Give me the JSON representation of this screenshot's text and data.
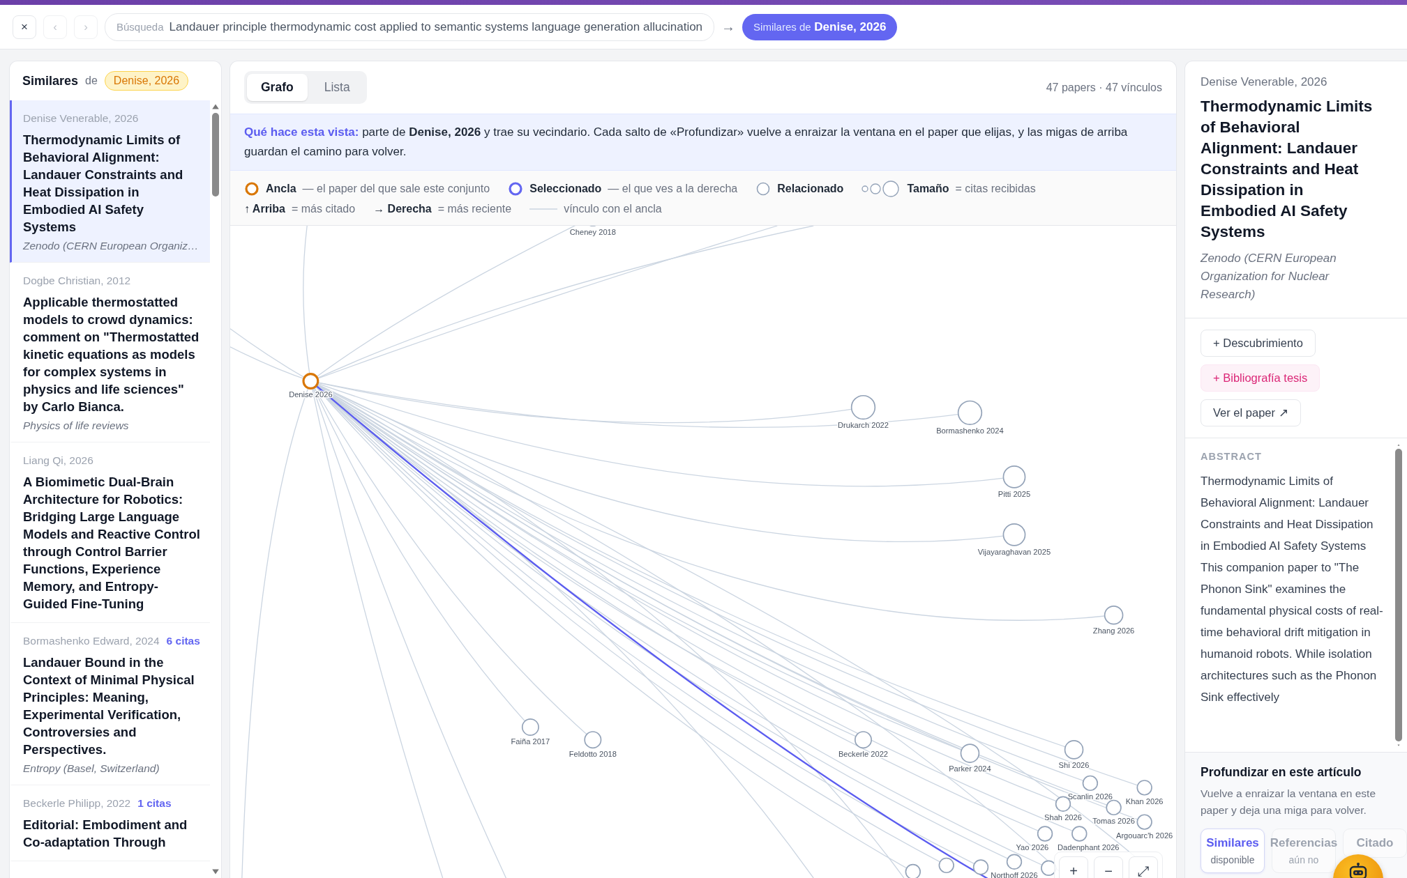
{
  "toolbar": {
    "close": "×",
    "back": "‹",
    "forward": "›",
    "back_disabled": true,
    "forward_disabled": true,
    "search": {
      "label": "Búsqueda",
      "value": "Landauer principle thermodynamic cost applied to semantic systems language generation allucination"
    },
    "arrow": "→",
    "crumb": {
      "prefix": "Similares de",
      "name": "Denise, 2026"
    }
  },
  "left": {
    "title": "Similares",
    "de": "de",
    "anchor": "Denise, 2026",
    "items": [
      {
        "meta": "Denise Venerable, 2026",
        "title": "Thermodynamic Limits of Behavioral Alignment: Landauer Constraints and Heat Dissipation in Embodied AI Safety Systems",
        "venue": "Zenodo (CERN European Organiz…",
        "selected": true
      },
      {
        "meta": "Dogbe Christian, 2012",
        "title": "Applicable thermostatted models to crowd dynamics: comment on \"Thermostatted kinetic equations as models for complex systems in physics and life sciences\" by Carlo Bianca.",
        "venue": "Physics of life reviews",
        "selected": false
      },
      {
        "meta": "Liang Qi, 2026",
        "title": "A Biomimetic Dual-Brain Architecture for Robotics: Bridging Large Language Models and Reactive Control through Control Barrier Functions, Experience Memory, and Entropy-Guided Fine-Tuning",
        "selected": false
      },
      {
        "meta": "Bormashenko Edward, 2024",
        "citas": "6 citas",
        "title": "Landauer Bound in the Context of Minimal Physical Principles: Meaning, Experimental Verification, Controversies and Perspectives.",
        "venue": "Entropy (Basel, Switzerland)",
        "selected": false
      },
      {
        "meta": "Beckerle Philipp, 2022",
        "citas": "1 citas",
        "title": "Editorial: Embodiment and Co-adaptation Through",
        "selected": false
      }
    ]
  },
  "center": {
    "tabs": [
      {
        "label": "Grafo",
        "selected": true
      },
      {
        "label": "Lista",
        "selected": false
      }
    ],
    "count": "47 papers · 47 vínculos",
    "info": "**Qué hace esta vista:** parte de **Denise, 2026** y trae su vecindario. Cada salto de «Profundizar» vuelve a enraizar la ventana en el paper que elijas, y las migas de arriba guardan el camino para volver.",
    "legend": [
      {
        "kind": "anchor",
        "label": "Ancla",
        "desc": "— el paper del que sale este conjunto"
      },
      {
        "kind": "selected",
        "label": "Seleccionado",
        "desc": "— el que ves a la derecha"
      },
      {
        "kind": "related",
        "label": "Relacionado"
      },
      {
        "kind": "size",
        "label": "Tamaño",
        "desc": "= citas recibidas"
      },
      {
        "kind": "arrow",
        "arrow": "↑",
        "label": "Arriba",
        "desc": "= más citado"
      },
      {
        "kind": "arrow",
        "arrow": "→",
        "label": "Derecha",
        "desc": "= más reciente"
      },
      {
        "kind": "edge",
        "desc": "vínculo con el ancla"
      }
    ],
    "nodes": [
      {
        "label": "Denise 2026",
        "kind": "anchor"
      },
      {
        "label": "Cheney 2018",
        "kind": "related"
      },
      {
        "label": "Drukarch 2022",
        "kind": "related"
      },
      {
        "label": "Bormashenko 2024",
        "kind": "related"
      },
      {
        "label": "Pitti 2025",
        "kind": "related"
      },
      {
        "label": "Vijayaraghavan 2025",
        "kind": "related"
      },
      {
        "label": "Zhang 2026",
        "kind": "related"
      },
      {
        "label": "Faiña 2017",
        "kind": "related"
      },
      {
        "label": "Feldotto 2018",
        "kind": "related"
      },
      {
        "label": "Beckerle 2022",
        "kind": "related"
      },
      {
        "label": "Parker 2024",
        "kind": "related"
      },
      {
        "label": "Shi 2026",
        "kind": "related"
      },
      {
        "label": "Scanlin 2026",
        "kind": "related"
      },
      {
        "label": "Khan 2026",
        "kind": "related"
      },
      {
        "label": "Shah 2026",
        "kind": "related"
      },
      {
        "label": "Tomas 2026",
        "kind": "related"
      },
      {
        "label": "Argouarc'h 2026",
        "kind": "related"
      },
      {
        "label": "Yao 2026",
        "kind": "related"
      },
      {
        "label": "Dadenphant 2026",
        "kind": "related"
      },
      {
        "label": "Northoff 2026",
        "kind": "related"
      }
    ],
    "zoom": [
      "+",
      "−",
      "⤢"
    ]
  },
  "right": {
    "meta": "Denise Venerable, 2026",
    "title": "Thermodynamic Limits of Behavioral Alignment: Landauer Constraints and Heat Dissipation in Embodied AI Safety Systems",
    "venue": "Zenodo (CERN European Organization for Nuclear Research)",
    "actions": [
      {
        "label": "+ Descubrimiento",
        "kind": "outline"
      },
      {
        "label": "+ Bibliografía tesis",
        "kind": "pink"
      },
      {
        "label": "Ver el paper ↗",
        "kind": "outline"
      }
    ],
    "abstract_heading": "ABSTRACT",
    "abstract": "Thermodynamic Limits of Behavioral Alignment: Landauer Constraints and Heat Dissipation in Embodied AI Safety Systems This companion paper to \"The Phonon Sink\" examines the fundamental physical costs of real-time behavioral drift mitigation in humanoid robots. While isolation architectures such as the Phonon Sink effectively",
    "deepen": {
      "title": "Profundizar en este artículo",
      "desc": "Vuelve a enraizar la ventana en este paper y deja una miga para volver.",
      "options": [
        {
          "label": "Similares",
          "status": "disponible",
          "selected": true,
          "disabled": false
        },
        {
          "label": "Referencias",
          "status": "aún no",
          "selected": false,
          "disabled": true
        },
        {
          "label": "Citado",
          "selected": false,
          "disabled": true
        }
      ]
    }
  }
}
